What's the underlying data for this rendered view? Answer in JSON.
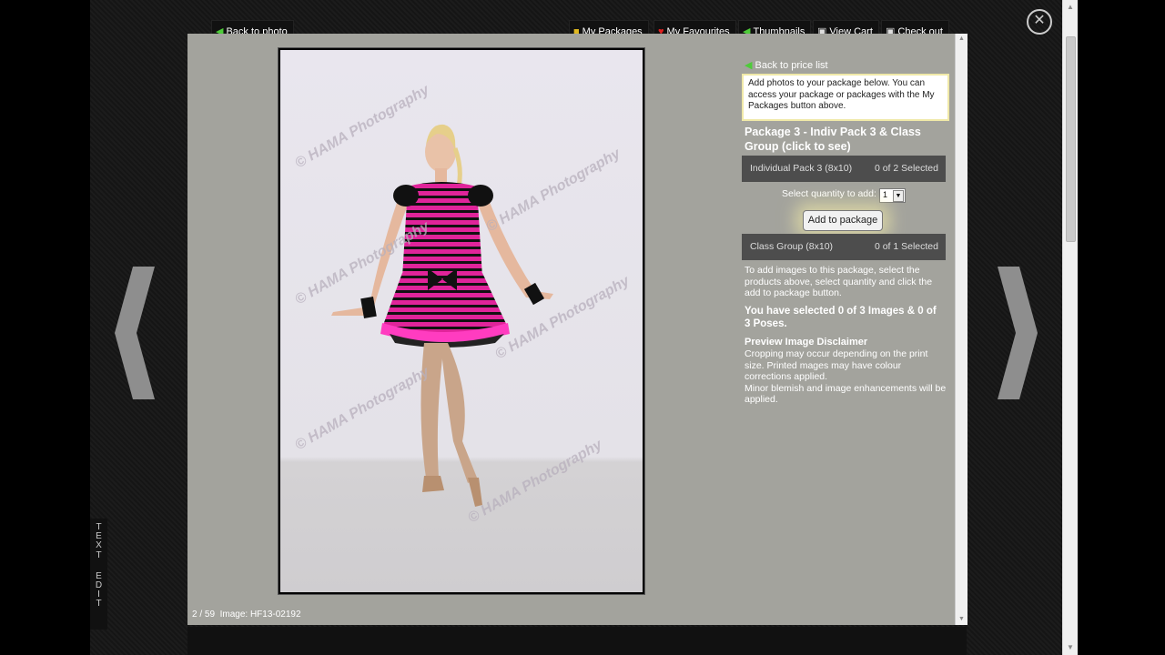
{
  "toolbar": {
    "back_to_photo": "Back to photo",
    "my_packages": "My Packages",
    "my_favourites": "My Favourites",
    "thumbnails": "Thumbnails",
    "view_cart": "View Cart",
    "check_out": "Check out"
  },
  "icons": {
    "close": "close-icon",
    "prev": "chevron-left-icon",
    "next": "chevron-right-icon"
  },
  "sidebar": {
    "back_to_price_list": "Back to price list",
    "info_text": "Add photos to your package below. You can access your package or packages with the My Packages button above.",
    "package_title": "Package 3 - Indiv Pack 3 & Class Group (click to see)",
    "products": [
      {
        "name": "Individual Pack 3 (8x10)",
        "status": "0 of 2 Selected"
      },
      {
        "name": "Class Group (8x10)",
        "status": "0 of 1 Selected"
      }
    ],
    "quantity_label": "Select quantity to add:",
    "quantity_value": "1",
    "add_button": "Add to package",
    "help_text": "To add images to this package, select the products above, select quantity and click the add to package button.",
    "selected_summary": "You have selected 0 of 3 Images & 0 of 3 Poses.",
    "disclaimer_title": "Preview Image Disclaimer",
    "disclaimer_line1": "Cropping may occur depending on the print size. Printed mages may have colour corrections applied.",
    "disclaimer_line2": "Minor blemish and image enhancements will be applied."
  },
  "photo": {
    "counter": "2 / 59",
    "image_label": "Image: HF13-02192"
  },
  "text_edit": {
    "letters": [
      "T",
      "E",
      "X",
      "T",
      "",
      "E",
      "D",
      "I",
      "T"
    ]
  },
  "colors": {
    "panel": "#a3a39d",
    "product_row": "#4d4d4d",
    "dress_pink": "#e0249a"
  }
}
